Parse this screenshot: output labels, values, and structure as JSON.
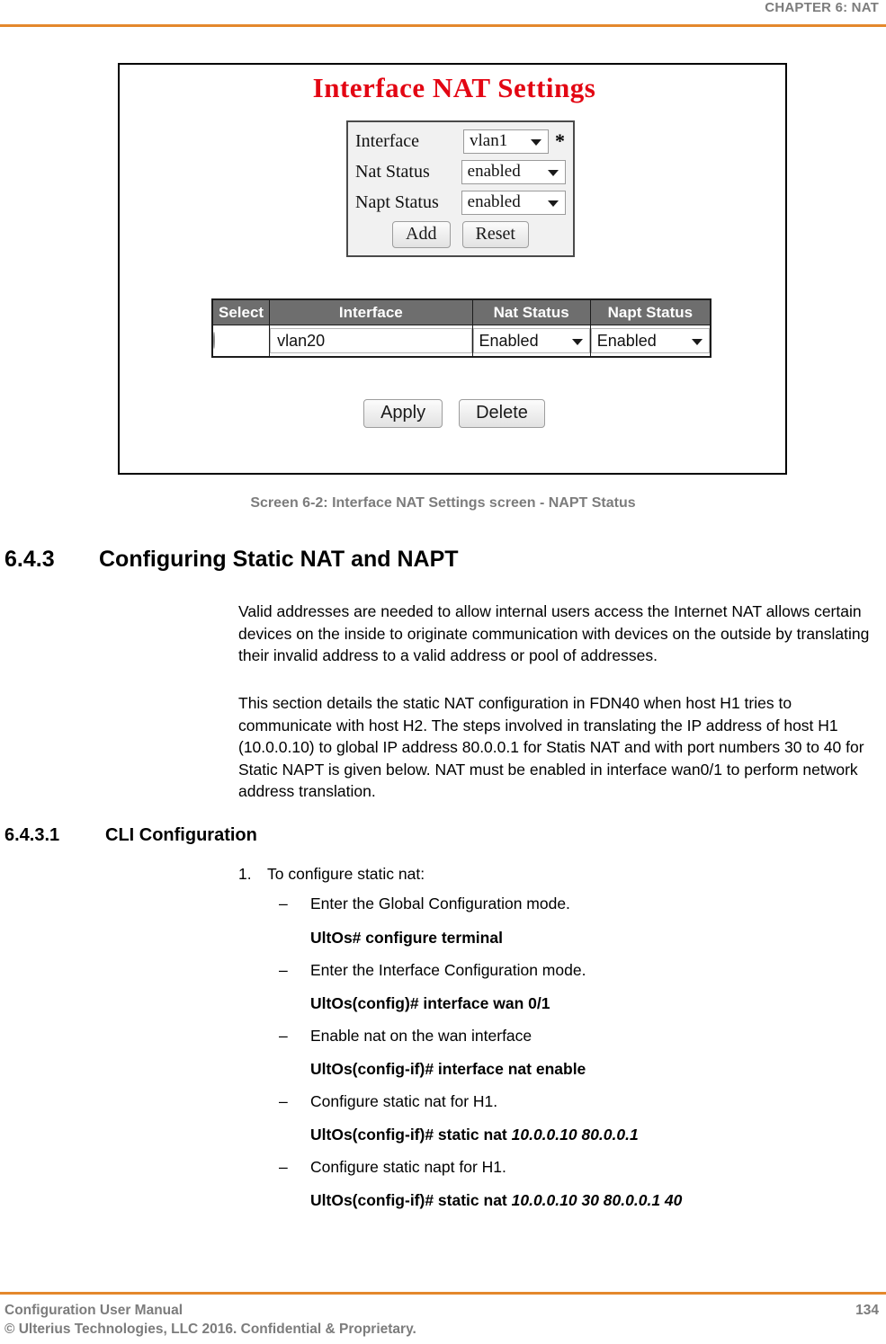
{
  "header": {
    "chapter": "CHAPTER 6: NAT"
  },
  "figure": {
    "title": "Interface NAT Settings",
    "caption": "Screen 6-2: Interface NAT Settings screen - NAPT Status",
    "form": {
      "rows": [
        {
          "label": "Interface",
          "value": "vlan1",
          "required_mark": "*"
        },
        {
          "label": "Nat Status",
          "value": "enabled",
          "required_mark": ""
        },
        {
          "label": "Napt Status",
          "value": "enabled",
          "required_mark": ""
        }
      ],
      "add_label": "Add",
      "reset_label": "Reset"
    },
    "table": {
      "columns": [
        "Select",
        "Interface",
        "Nat Status",
        "Napt Status"
      ],
      "rows": [
        {
          "interface": "vlan20",
          "nat_status": "Enabled",
          "napt_status": "Enabled"
        }
      ],
      "apply_label": "Apply",
      "delete_label": "Delete"
    },
    "colors": {
      "title_red": "#e30613",
      "table_header_gray": "#6e6e6e",
      "radio_blue": "#1f7fd0"
    }
  },
  "content": {
    "section": {
      "number": "6.4.3",
      "title": "Configuring Static NAT and NAPT"
    },
    "paragraphs": [
      "Valid addresses are needed to allow internal users access the Internet NAT allows certain devices on the inside to originate communication with devices on the outside by translating their invalid address to a valid address or pool of addresses.",
      "This section details the static NAT configuration in FDN40 when host H1 tries to communicate with host H2. The steps involved in translating the IP address of host H1 (10.0.0.10) to global IP address 80.0.0.1 for Statis NAT and with port numbers 30 to 40 for Static NAPT is given below. NAT must be enabled in interface wan0/1 to perform network address translation."
    ],
    "subsection": {
      "number": "6.4.3.1",
      "title": "CLI Configuration"
    },
    "steps": [
      {
        "marker": "1.",
        "text": "To configure static nat:"
      }
    ],
    "cli_items": [
      {
        "marker": "–",
        "text": "Enter the Global Configuration mode.",
        "command_prefix": "UltOs# configure terminal",
        "command_args": ""
      },
      {
        "marker": "–",
        "text": "Enter the Interface Configuration mode.",
        "command_prefix": "UltOs(config)# interface wan 0/1",
        "command_args": ""
      },
      {
        "marker": "–",
        "text": "Enable nat on the wan interface",
        "command_prefix": "UltOs(config-if)# interface nat enable",
        "command_args": ""
      },
      {
        "marker": "–",
        "text": "Configure static nat for H1.",
        "command_prefix": "UltOs(config-if)# static nat ",
        "command_args": "10.0.0.10 80.0.0.1"
      },
      {
        "marker": "–",
        "text": "Configure static napt for H1.",
        "command_prefix": "UltOs(config-if)# static nat ",
        "command_args": "10.0.0.10 30 80.0.0.1 40"
      }
    ]
  },
  "footer": {
    "manual_title": "Configuration User Manual",
    "copyright": "© Ulterius Technologies, LLC 2016. Confidential & Proprietary.",
    "page_number": "134"
  }
}
